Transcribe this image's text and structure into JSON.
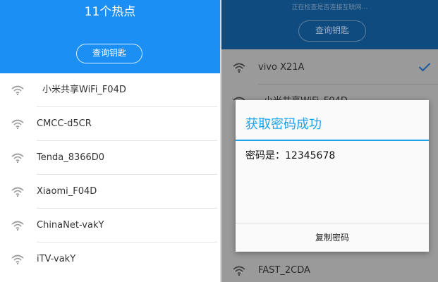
{
  "left": {
    "hotspot_count": "11个热点",
    "query_button": "查询钥匙",
    "networks": [
      {
        "ssid": "小米共享WiFi_F04D"
      },
      {
        "ssid": "CMCC-d5CR"
      },
      {
        "ssid": "Tenda_8366D0"
      },
      {
        "ssid": "Xiaomi_F04D"
      },
      {
        "ssid": "ChinaNet-vakY"
      },
      {
        "ssid": "iTV-vakY"
      }
    ]
  },
  "right": {
    "checking_text": "正在检查是否连接互联网…",
    "query_button": "查询钥匙",
    "networks": [
      {
        "ssid": "vivo X21A",
        "selected": true
      },
      {
        "ssid": "小米共享WiFi_F04D"
      },
      {
        "ssid": "FAST_2CDA"
      }
    ]
  },
  "dialog": {
    "title": "获取密码成功",
    "message": "密码是：12345678",
    "copy_button": "复制密码"
  },
  "colors": {
    "primary": "#1c8ff5",
    "dialog_accent": "#1aa3ec",
    "dimmed_header": "#0f4b7e"
  },
  "icons": [
    "wifi-icon",
    "check-icon"
  ]
}
